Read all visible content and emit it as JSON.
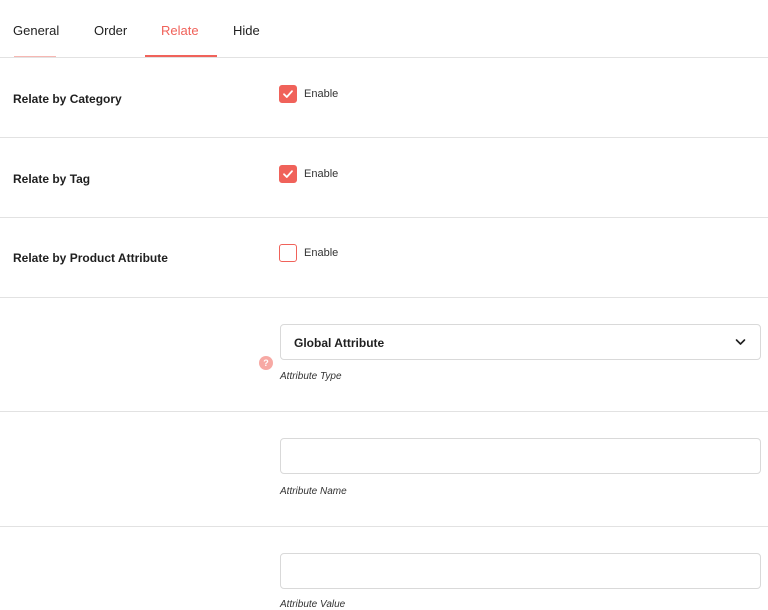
{
  "tabs": [
    {
      "label": "General",
      "active": false
    },
    {
      "label": "Order",
      "active": false
    },
    {
      "label": "Relate",
      "active": true
    },
    {
      "label": "Hide",
      "active": false
    }
  ],
  "rows": {
    "category": {
      "label": "Relate by Category",
      "checkbox_label": "Enable",
      "checked": true
    },
    "tag": {
      "label": "Relate by Tag",
      "checkbox_label": "Enable",
      "checked": true
    },
    "attribute": {
      "label": "Relate by Product Attribute",
      "checkbox_label": "Enable",
      "checked": false
    }
  },
  "attribute_type": {
    "selected": "Global Attribute",
    "helper": "Attribute Type",
    "help_icon": "?"
  },
  "attribute_name": {
    "value": "",
    "helper": "Attribute Name"
  },
  "attribute_value": {
    "value": "",
    "helper": "Attribute Value"
  },
  "colors": {
    "accent": "#f0625a",
    "help_icon_bg": "#f7a9a4",
    "divider": "#e2e2e2"
  },
  "icons": {
    "checkmark": "check-icon",
    "select_arrow": "chevron-down-icon",
    "help": "question-mark-icon"
  }
}
